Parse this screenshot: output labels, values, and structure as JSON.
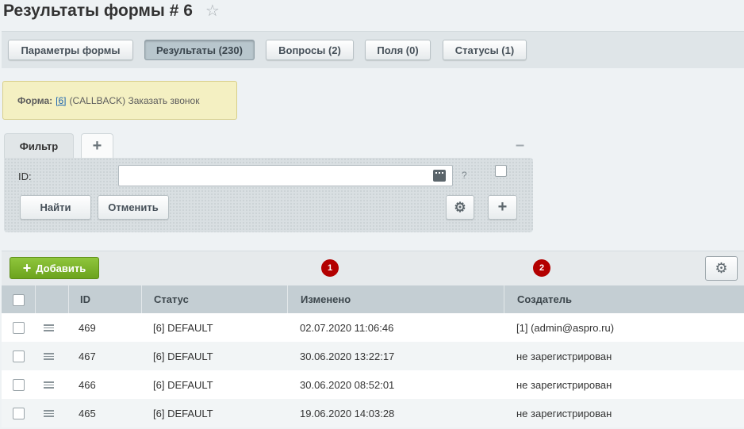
{
  "page": {
    "title": "Результаты формы # 6",
    "star_icon": "star-icon"
  },
  "tabs": [
    {
      "label": "Параметры формы",
      "active": false
    },
    {
      "label": "Результаты (230)",
      "active": true
    },
    {
      "label": "Вопросы (2)",
      "active": false
    },
    {
      "label": "Поля (0)",
      "active": false
    },
    {
      "label": "Статусы (1)",
      "active": false
    }
  ],
  "info": {
    "label": "Форма:",
    "link": "[6]",
    "text": "(CALLBACK) Заказать звонок"
  },
  "filter": {
    "tab_label": "Фильтр",
    "add_tab_glyph": "+",
    "collapse_glyph": "–",
    "id_label": "ID:",
    "id_value": "",
    "help": "?",
    "find_label": "Найти",
    "cancel_label": "Отменить",
    "settings_glyph": "⚙",
    "add_glyph": "+"
  },
  "toolbar": {
    "add_label": "Добавить",
    "add_glyph": "+",
    "badges": [
      "1",
      "2"
    ],
    "settings_glyph": "⚙"
  },
  "columns": [
    "ID",
    "Статус",
    "Изменено",
    "Создатель"
  ],
  "rows": [
    {
      "id": "469",
      "status": "[6] DEFAULT",
      "modified": "02.07.2020 11:06:46",
      "creator": "[1] (admin@aspro.ru)"
    },
    {
      "id": "467",
      "status": "[6] DEFAULT",
      "modified": "30.06.2020 13:22:17",
      "creator": "не зарегистрирован"
    },
    {
      "id": "466",
      "status": "[6] DEFAULT",
      "modified": "30.06.2020 08:52:01",
      "creator": "не зарегистрирован"
    },
    {
      "id": "465",
      "status": "[6] DEFAULT",
      "modified": "19.06.2020 14:03:28",
      "creator": "не зарегистрирован"
    }
  ],
  "colors": {
    "accent_green": "#7ab52c",
    "badge_red": "#b30000",
    "link_blue": "#2067b0"
  }
}
